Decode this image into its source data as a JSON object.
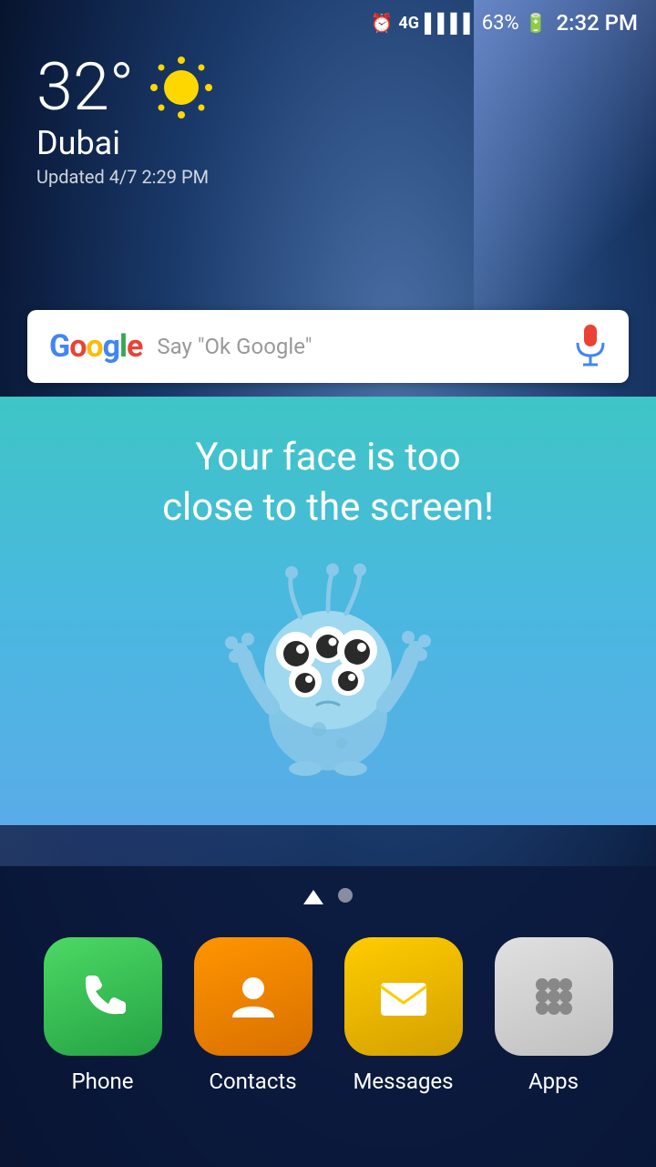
{
  "statusBar": {
    "time": "2:32 PM",
    "battery": "63%",
    "signal": "4G"
  },
  "weather": {
    "temperature": "32°",
    "city": "Dubai",
    "updated": "Updated 4/7 2:29 PM"
  },
  "googleBar": {
    "logo": "Google",
    "placeholder": "Say \"Ok Google\""
  },
  "notification": {
    "message": "Your face is too\nclose to the screen!"
  },
  "pageIndicators": {
    "home": "⌂",
    "dots": 1
  },
  "dock": {
    "apps": [
      {
        "id": "phone",
        "label": "Phone"
      },
      {
        "id": "contacts",
        "label": "Contacts"
      },
      {
        "id": "messages",
        "label": "Messages"
      },
      {
        "id": "apps",
        "label": "Apps"
      }
    ]
  }
}
